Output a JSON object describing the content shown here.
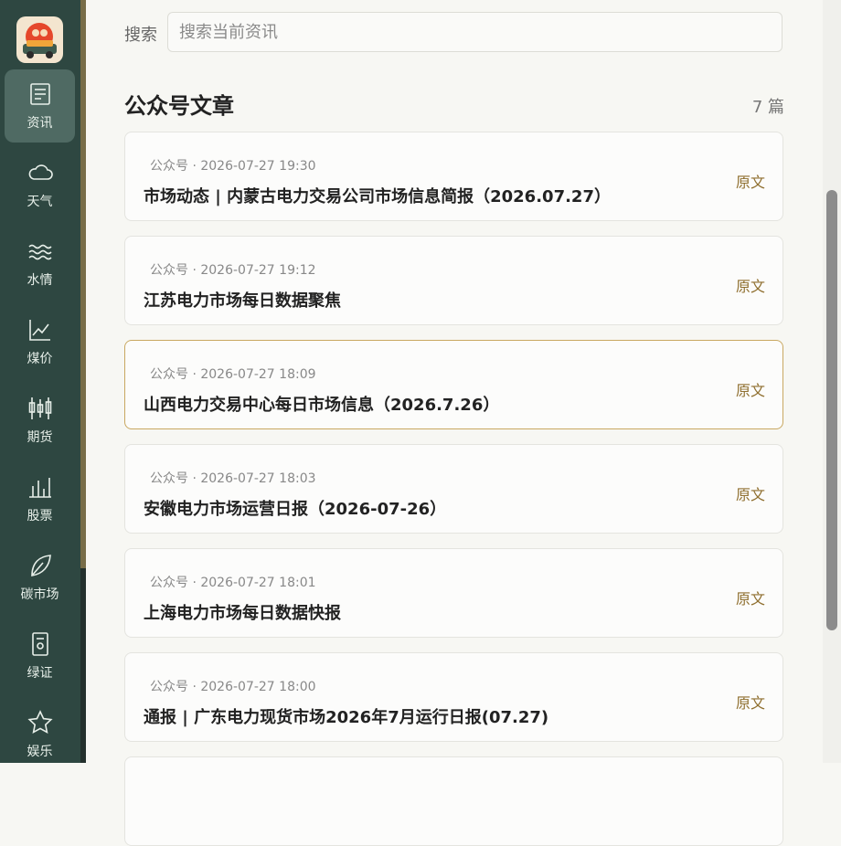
{
  "sidebar": {
    "items": [
      {
        "label": "资讯",
        "icon": "news-icon",
        "active": true
      },
      {
        "label": "天气",
        "icon": "cloud-icon",
        "active": false
      },
      {
        "label": "水情",
        "icon": "water-icon",
        "active": false
      },
      {
        "label": "煤价",
        "icon": "line-chart-icon",
        "active": false
      },
      {
        "label": "期货",
        "icon": "candlestick-icon",
        "active": false
      },
      {
        "label": "股票",
        "icon": "bar-chart-icon",
        "active": false
      },
      {
        "label": "碳市场",
        "icon": "leaf-icon",
        "active": false
      },
      {
        "label": "绿证",
        "icon": "certificate-icon",
        "active": false
      },
      {
        "label": "娱乐",
        "icon": "star-icon",
        "active": false
      }
    ]
  },
  "search": {
    "label": "搜索",
    "placeholder": "搜索当前资讯",
    "value": ""
  },
  "section": {
    "title": "公众号文章",
    "count": "7 篇"
  },
  "articles": [
    {
      "meta": "公众号 · 2026-07-27 19:30",
      "title": "市场动态 | 内蒙古电力交易公司市场信息简报（2026.07.27）",
      "link": "原文"
    },
    {
      "meta": "公众号 · 2026-07-27 19:12",
      "title": "江苏电力市场每日数据聚焦",
      "link": "原文"
    },
    {
      "meta": "公众号 · 2026-07-27 18:09",
      "title": "山西电力交易中心每日市场信息（2026.7.26）",
      "link": "原文"
    },
    {
      "meta": "公众号 · 2026-07-27 18:03",
      "title": "安徽电力市场运营日报（2026-07-26）",
      "link": "原文"
    },
    {
      "meta": "公众号 · 2026-07-27 18:01",
      "title": "上海电力市场每日数据快报",
      "link": "原文"
    },
    {
      "meta": "公众号 · 2026-07-27 18:00",
      "title": "通报 | 广东电力现货市场2026年7月运行日报(07.27)",
      "link": "原文"
    }
  ],
  "colors": {
    "sidebar": "#2e4741",
    "accent": "#8f6f2f",
    "selected_border": "#c9a861"
  }
}
